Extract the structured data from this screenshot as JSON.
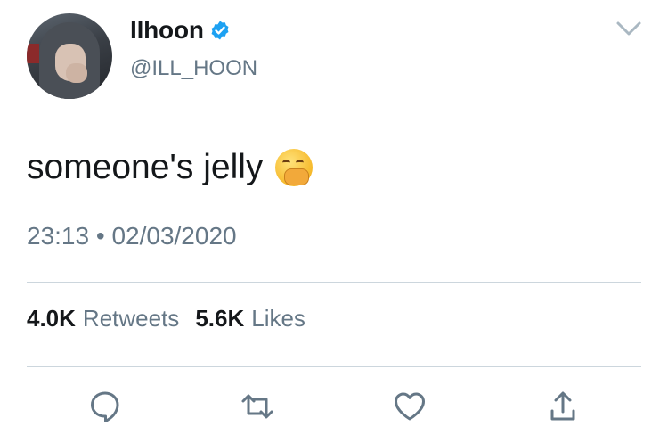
{
  "user": {
    "display_name": "Ilhoon",
    "handle": "@ILL_HOON",
    "verified": true,
    "avatar": "profile-photo"
  },
  "tweet": {
    "text": "someone's jelly",
    "emoji": "yawning-face-emoji",
    "time": "23:13",
    "separator": "•",
    "date": "02/03/2020"
  },
  "stats": {
    "retweets_count": "4.0K",
    "retweets_label": "Retweets",
    "likes_count": "5.6K",
    "likes_label": "Likes"
  },
  "actions": [
    "reply-icon",
    "retweet-icon",
    "like-icon",
    "share-icon"
  ],
  "colors": {
    "text": "#14171a",
    "muted": "#657786",
    "accent": "#1da1f2",
    "divider": "#ccd6dd"
  }
}
